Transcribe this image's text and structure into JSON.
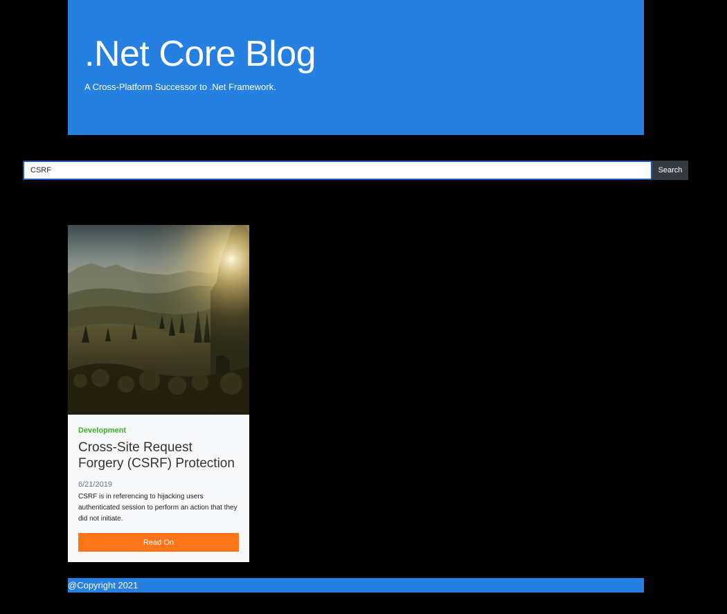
{
  "header": {
    "title": ".Net Core Blog",
    "subtitle": "A Cross-Platform Successor to .Net Framework."
  },
  "search": {
    "value": "CSRF",
    "button_label": "Search"
  },
  "posts": [
    {
      "category": "Development",
      "title": "Cross-Site Request Forgery (CSRF) Protection",
      "date": "6/21/2019",
      "excerpt": "CSRF is in referencing to hijacking users authenticated session to perform an action that they did not initiate.",
      "button_label": "Read On",
      "image_icon": "landscape-photo"
    }
  ],
  "footer": {
    "text": "@Copyright 2021"
  },
  "colors": {
    "header_bg": "#2680e2",
    "search_button_bg": "#343a40",
    "category": "#3fae2a",
    "read_button": "#ff7518",
    "background": "#000000"
  }
}
